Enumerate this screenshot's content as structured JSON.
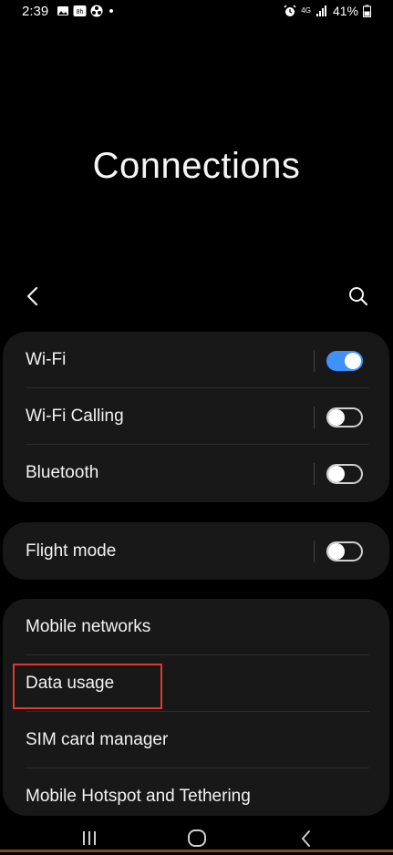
{
  "status_bar": {
    "time": "2:39",
    "network": "4G",
    "battery": "41%"
  },
  "page": {
    "title": "Connections"
  },
  "toggles": {
    "wifi": true,
    "wifi_calling": false,
    "bluetooth": false,
    "flight_mode": false
  },
  "settings": {
    "wifi_label": "Wi-Fi",
    "wifi_calling_label": "Wi-Fi Calling",
    "bluetooth_label": "Bluetooth",
    "flight_mode_label": "Flight mode",
    "mobile_networks_label": "Mobile networks",
    "data_usage_label": "Data usage",
    "sim_card_manager_label": "SIM card manager",
    "hotspot_label": "Mobile Hotspot and Tethering"
  },
  "colors": {
    "background": "#000000",
    "card": "#181818",
    "accent": "#3e91ff",
    "highlight": "#e0392c"
  },
  "icons": {
    "back": "chevron-left-icon",
    "search": "search-icon",
    "recents": "recents-icon",
    "home": "home-icon",
    "nav_back": "nav-back-icon"
  }
}
